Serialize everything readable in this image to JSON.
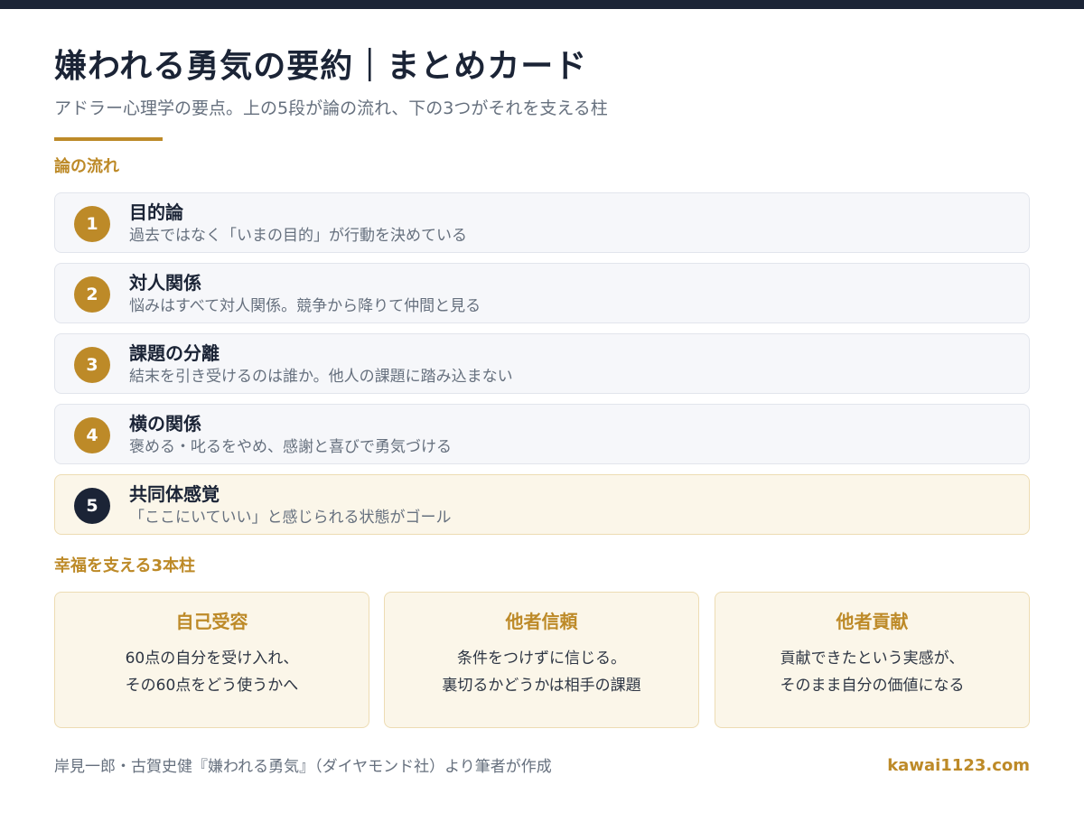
{
  "header": {
    "title": "嫌われる勇気の要約｜まとめカード",
    "subtitle": "アドラー心理学の要点。上の5段が論の流れ、下の3つがそれを支える柱"
  },
  "flow": {
    "label": "論の流れ",
    "steps": [
      {
        "number": "1",
        "title": "目的論",
        "desc": "過去ではなく「いまの目的」が行動を決めている"
      },
      {
        "number": "2",
        "title": "対人関係",
        "desc": "悩みはすべて対人関係。競争から降りて仲間と見る"
      },
      {
        "number": "3",
        "title": "課題の分離",
        "desc": "結末を引き受けるのは誰か。他人の課題に踏み込まない"
      },
      {
        "number": "4",
        "title": "横の関係",
        "desc": "褒める・叱るをやめ、感謝と喜びで勇気づける"
      },
      {
        "number": "5",
        "title": "共同体感覚",
        "desc": "「ここにいていい」と感じられる状態がゴール"
      }
    ]
  },
  "pillars": {
    "label": "幸福を支える3本柱",
    "items": [
      {
        "title": "自己受容",
        "line1": "60点の自分を受け入れ、",
        "line2": "その60点をどう使うかへ"
      },
      {
        "title": "他者信頼",
        "line1": "条件をつけずに信じる。",
        "line2": "裏切るかどうかは相手の課題"
      },
      {
        "title": "他者貢献",
        "line1": "貢献できたという実感が、",
        "line2": "そのまま自分の価値になる"
      }
    ]
  },
  "footer": {
    "credit": "岸見一郎・古賀史健『嫌われる勇気』（ダイヤモンド社）より筆者が作成",
    "site": "kawai1123.com"
  },
  "colors": {
    "accent": "#bd8a28",
    "navy": "#1b2436",
    "card_bg": "#f6f7fa",
    "highlight_bg": "#fbf6e9"
  }
}
